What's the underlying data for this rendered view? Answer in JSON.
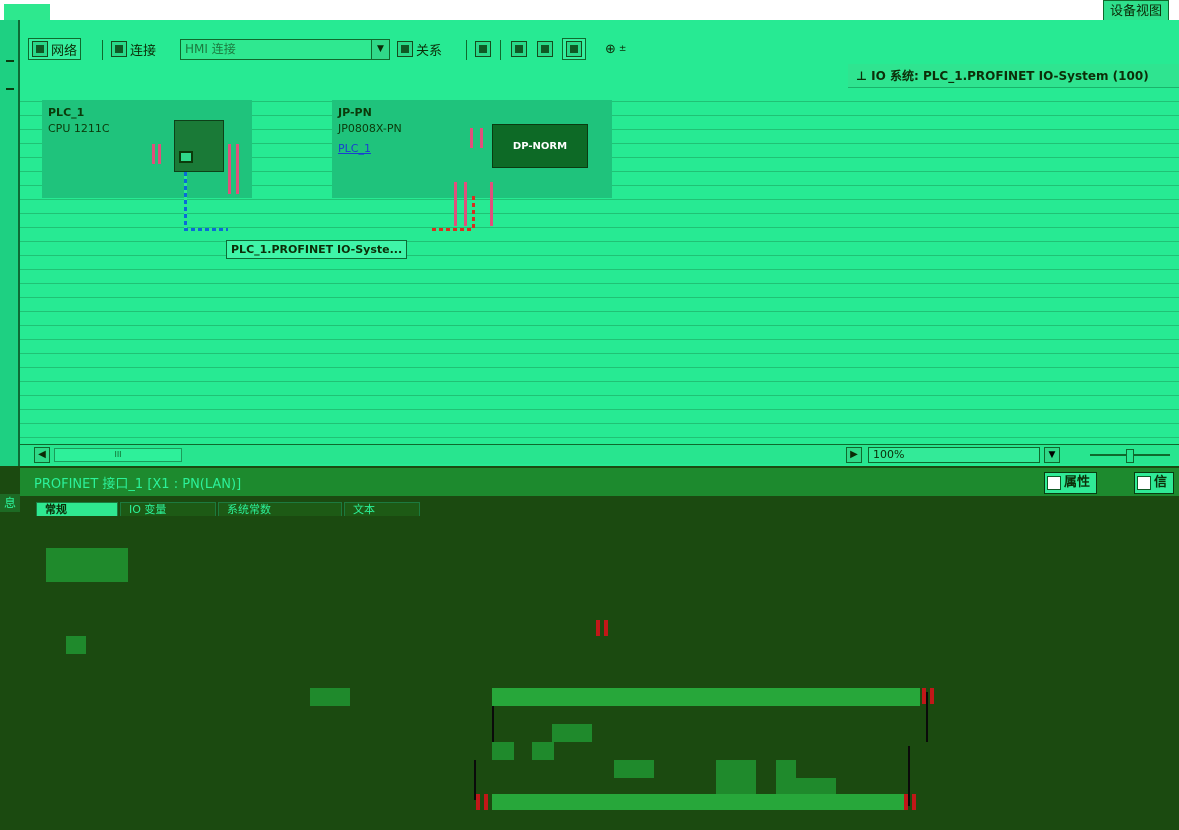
{
  "window": {
    "right_label": "设备视图"
  },
  "toolbar": {
    "network_label": "网络",
    "connection_label": "连接",
    "connection_select": "HMI 连接",
    "relations_label": "关系"
  },
  "io_system": {
    "label": "IO 系统: PLC_1.PROFINET IO-System (100)"
  },
  "devices": [
    {
      "name": "PLC_1",
      "type": "CPU 1211C"
    },
    {
      "name": "JP-PN",
      "type": "JP0808X-PN",
      "link": "PLC_1",
      "module": "DP-NORM"
    }
  ],
  "network": {
    "label": "PLC_1.PROFINET IO-Syste..."
  },
  "zoom": {
    "value": "100%"
  },
  "inspector": {
    "title": "PROFINET 接口_1 [X1 : PN(LAN)]",
    "properties_label": "属性",
    "info_label": "信",
    "side_label": "息",
    "tabs": [
      "常规",
      "IO 变量",
      "系统常数",
      "文本"
    ]
  }
}
